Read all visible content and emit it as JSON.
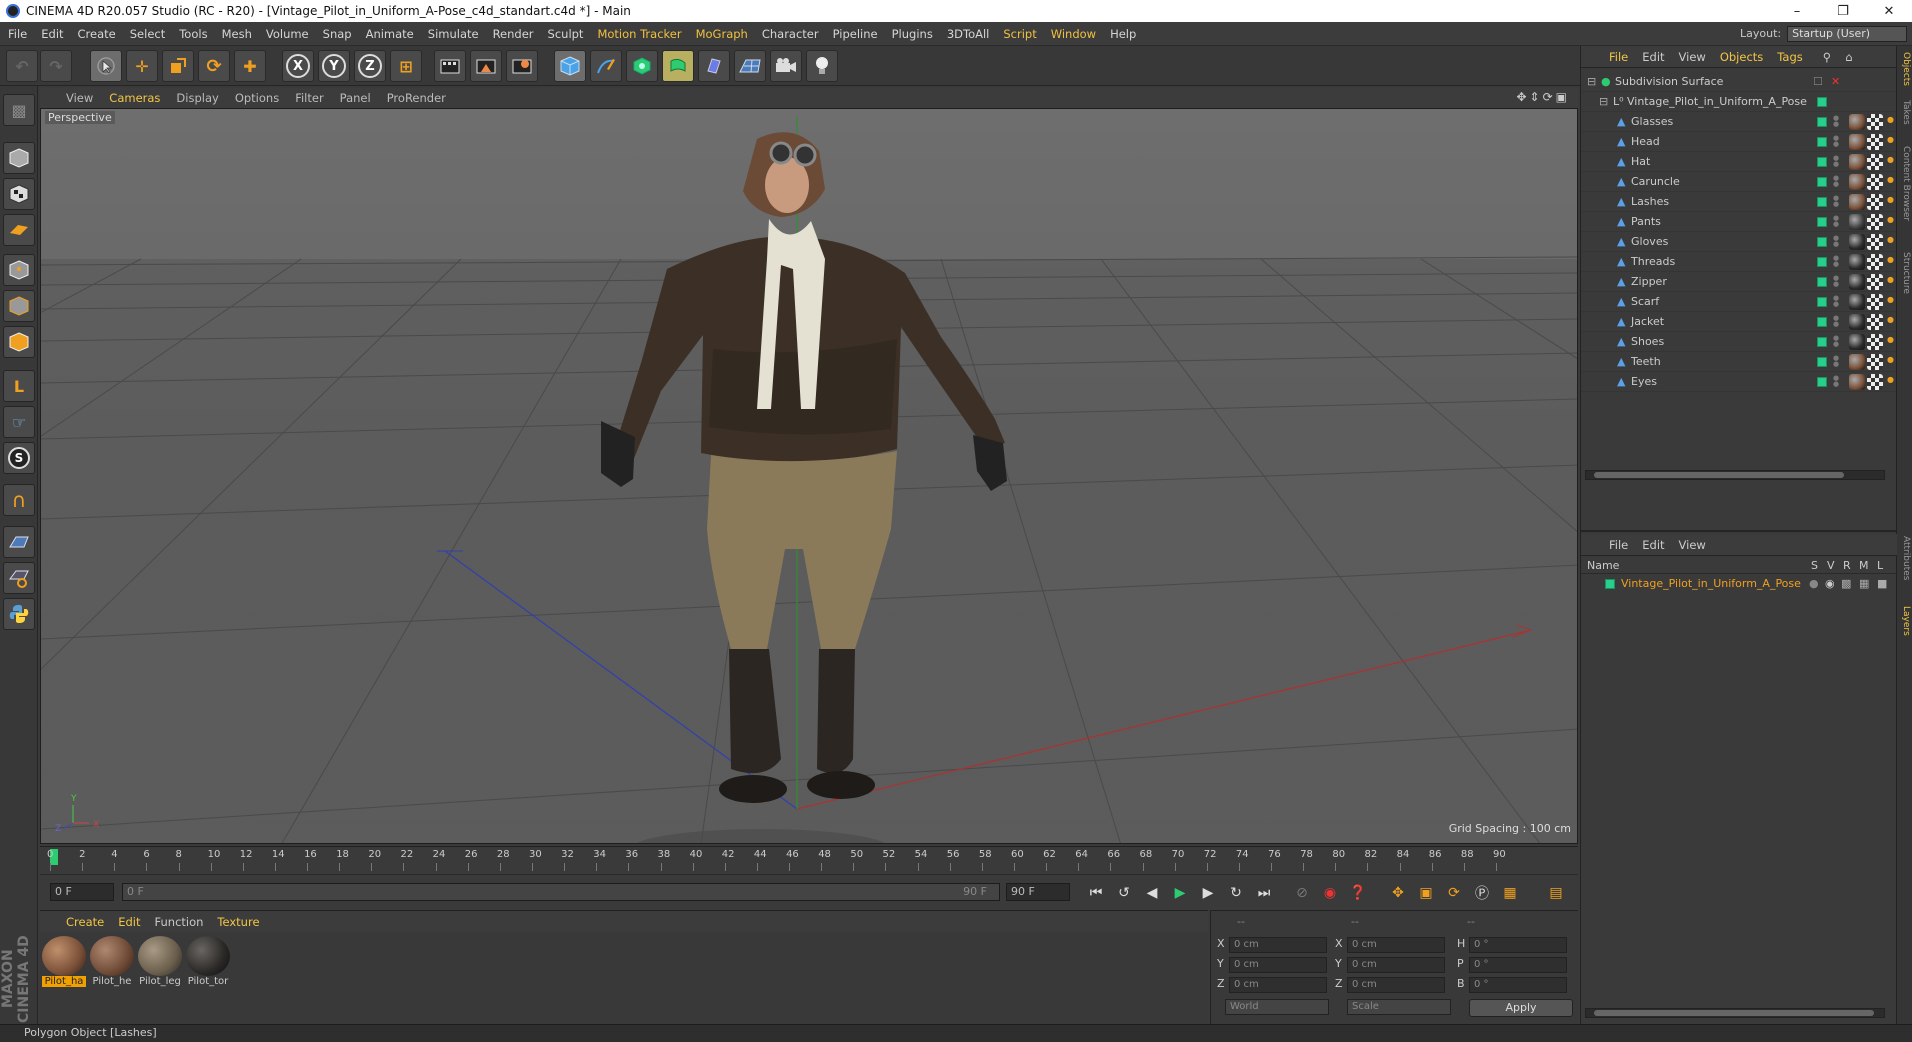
{
  "window": {
    "title": "CINEMA 4D R20.057 Studio (RC - R20) - [Vintage_Pilot_in_Uniform_A-Pose_c4d_standart.c4d *] - Main"
  },
  "menubar": [
    "File",
    "Edit",
    "Create",
    "Select",
    "Tools",
    "Mesh",
    "Volume",
    "Snap",
    "Animate",
    "Simulate",
    "Render",
    "Sculpt",
    "Motion Tracker",
    "MoGraph",
    "Character",
    "Pipeline",
    "Plugins",
    "3DToAll",
    "Script",
    "Window",
    "Help"
  ],
  "layout": {
    "label": "Layout:",
    "value": "Startup (User)"
  },
  "toolbar": {
    "x": "X",
    "y": "Y",
    "z": "Z"
  },
  "viewport": {
    "menu": [
      "View",
      "Cameras",
      "Display",
      "Options",
      "Filter",
      "Panel",
      "ProRender"
    ],
    "active_menu": "Cameras",
    "label": "Perspective",
    "grid_spacing": "Grid Spacing : 100 cm",
    "axis": {
      "y": "Y",
      "x": "X",
      "z": "Z"
    }
  },
  "timeline": {
    "ticks": [
      "0",
      "2",
      "4",
      "6",
      "8",
      "10",
      "12",
      "14",
      "16",
      "18",
      "20",
      "22",
      "24",
      "26",
      "28",
      "30",
      "32",
      "34",
      "36",
      "38",
      "40",
      "42",
      "44",
      "46",
      "48",
      "50",
      "52",
      "54",
      "56",
      "58",
      "60",
      "62",
      "64",
      "66",
      "68",
      "70",
      "72",
      "74",
      "76",
      "78",
      "80",
      "82",
      "84",
      "86",
      "88",
      "90"
    ],
    "end_field": "0 F",
    "current": "0 F",
    "slider_start": "0 F",
    "slider_end": "90 F",
    "max": "90 F"
  },
  "materials": {
    "menu": [
      "Create",
      "Edit",
      "Function",
      "Texture"
    ],
    "items": [
      {
        "name": "Pilot_ha",
        "color": "#7a5038"
      },
      {
        "name": "Pilot_he",
        "color": "#6e4a36"
      },
      {
        "name": "Pilot_leg",
        "color": "#6a5e4c"
      },
      {
        "name": "Pilot_tor",
        "color": "#2a2826"
      }
    ]
  },
  "coords": {
    "header": [
      "--",
      "--",
      "--"
    ],
    "rows": [
      {
        "a": "X",
        "av": "0 cm",
        "b": "X",
        "bv": "0 cm",
        "c": "H",
        "cv": "0 °"
      },
      {
        "a": "Y",
        "av": "0 cm",
        "b": "Y",
        "bv": "0 cm",
        "c": "P",
        "cv": "0 °"
      },
      {
        "a": "Z",
        "av": "0 cm",
        "b": "Z",
        "bv": "0 cm",
        "c": "B",
        "cv": "0 °"
      }
    ],
    "mode": "World",
    "type": "Scale",
    "apply": "Apply"
  },
  "objects": {
    "menu": [
      "File",
      "Edit",
      "View",
      "Objects",
      "Tags"
    ],
    "root": "Subdivision Surface",
    "parent": "Vintage_Pilot_in_Uniform_A_Pose",
    "children": [
      "Glasses",
      "Head",
      "Hat",
      "Caruncle",
      "Lashes",
      "Pants",
      "Gloves",
      "Threads",
      "Zipper",
      "Scarf",
      "Jacket",
      "Shoes",
      "Teeth",
      "Eyes"
    ]
  },
  "layers": {
    "menu": [
      "File",
      "Edit",
      "View"
    ],
    "columns": {
      "name": "Name",
      "s": "S",
      "v": "V",
      "r": "R",
      "m": "M",
      "l": "L"
    },
    "row": "Vintage_Pilot_in_Uniform_A_Pose"
  },
  "right_tabs": [
    "Objects",
    "Takes",
    "Content Browser",
    "Structure",
    "Attributes",
    "Layers"
  ],
  "status": "Polygon Object [Lashes]",
  "maxon": "MAXON CINEMA 4D",
  "colors": {
    "accent": "#f2c645",
    "green": "#27d08a",
    "bg": "#3a3a3a"
  }
}
